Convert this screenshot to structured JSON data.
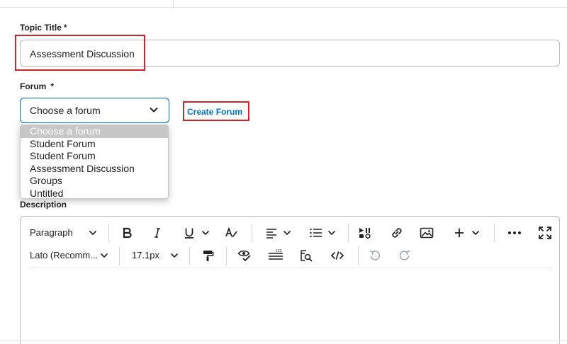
{
  "form": {
    "topic_title_label": "Topic Title",
    "required_marker": "*",
    "topic_title_value": "Assessment Discussion",
    "forum_label": "Forum",
    "forum_selected": "Choose a forum",
    "create_forum_link": "Create Forum",
    "forum_options": [
      {
        "label": "Choose a forum",
        "selected": true
      },
      {
        "label": "Student Forum",
        "selected": false
      },
      {
        "label": "Student Forum",
        "selected": false
      },
      {
        "label": "Assessment Discussion",
        "selected": false
      },
      {
        "label": "Groups",
        "selected": false
      },
      {
        "label": "Untitled",
        "selected": false
      }
    ],
    "description_label": "Description"
  },
  "toolbar": {
    "paragraph_style": "Paragraph",
    "font_family": "Lato (Recomm...",
    "font_size": "17.1px",
    "icons_row1": [
      "bold-icon",
      "italic-icon",
      "underline-icon",
      "text-format-icon",
      "align-icon",
      "list-icon",
      "insert-stuff-icon",
      "link-icon",
      "image-icon",
      "plus-icon",
      "more-icon",
      "fullscreen-icon"
    ],
    "icons_row2": [
      "format-painter-icon",
      "accessibility-checker-icon",
      "word-count-icon",
      "find-replace-icon",
      "source-code-icon",
      "undo-icon",
      "redo-icon"
    ]
  },
  "colors": {
    "highlight": "#d3232e",
    "link": "#006fbf",
    "focus_border": "#006fbf",
    "selected_option_bg": "#c7c7c7"
  }
}
